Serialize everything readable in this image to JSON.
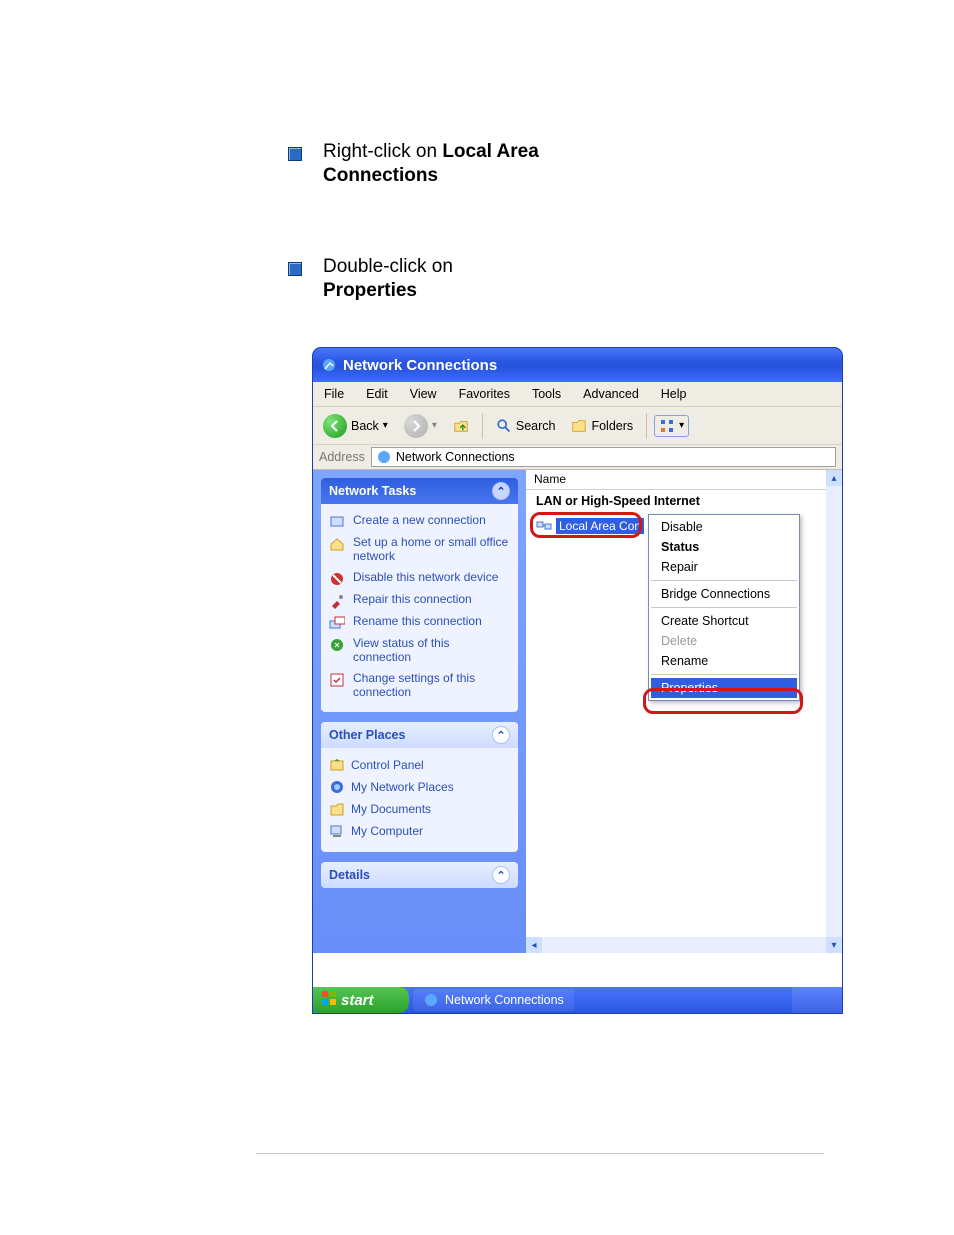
{
  "instructions": {
    "step1_pre": "Right-click on ",
    "step1_bold": "Local Area",
    "step1_line2": "Connections",
    "step2_pre": "Double-click on",
    "step2_bold": "Properties"
  },
  "window": {
    "title": "Network Connections",
    "menubar": [
      "File",
      "Edit",
      "View",
      "Favorites",
      "Tools",
      "Advanced",
      "Help"
    ],
    "toolbar": {
      "back": "Back",
      "search": "Search",
      "folders": "Folders"
    },
    "address_label": "Address",
    "address_value": "Network Connections"
  },
  "sidepane": {
    "tasks": {
      "head": "Network Tasks",
      "items": [
        "Create a new connection",
        "Set up a home or small office network",
        "Disable this network device",
        "Repair this connection",
        "Rename this connection",
        "View status of this connection",
        "Change settings of this connection"
      ]
    },
    "places": {
      "head": "Other Places",
      "items": [
        "Control Panel",
        "My Network Places",
        "My Documents",
        "My Computer"
      ]
    },
    "details": {
      "head": "Details"
    }
  },
  "content": {
    "col_name": "Name",
    "group": "LAN or High-Speed Internet",
    "item_label": "Local Area Con"
  },
  "context_menu": {
    "items": [
      {
        "label": "Disable",
        "bold": false,
        "disabled": false,
        "selected": false
      },
      {
        "label": "Status",
        "bold": true,
        "disabled": false,
        "selected": false
      },
      {
        "label": "Repair",
        "bold": false,
        "disabled": false,
        "selected": false
      },
      {
        "sep": true
      },
      {
        "label": "Bridge Connections",
        "bold": false,
        "disabled": false,
        "selected": false
      },
      {
        "sep": true
      },
      {
        "label": "Create Shortcut",
        "bold": false,
        "disabled": false,
        "selected": false
      },
      {
        "label": "Delete",
        "bold": false,
        "disabled": true,
        "selected": false
      },
      {
        "label": "Rename",
        "bold": false,
        "disabled": false,
        "selected": false
      },
      {
        "sep": true
      },
      {
        "label": "Properties",
        "bold": false,
        "disabled": false,
        "selected": true
      }
    ]
  },
  "taskbar": {
    "start": "start",
    "tab": "Network Connections"
  }
}
